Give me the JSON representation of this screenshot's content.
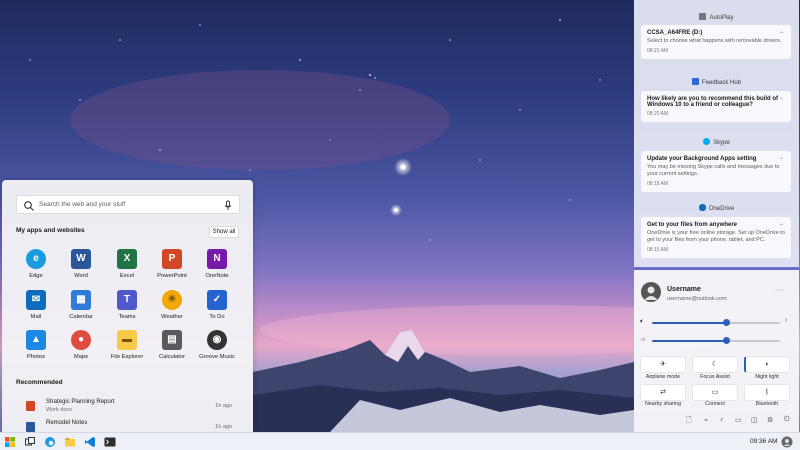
{
  "start_menu": {
    "search_placeholder": "Search the web and your stuff",
    "apps_header": "My apps and websites",
    "show_all": "Show all",
    "apps": [
      {
        "label": "Edge",
        "icon": "edge-icon",
        "color": "#1a9be0"
      },
      {
        "label": "Word",
        "icon": "word-icon",
        "color": "#2b579a"
      },
      {
        "label": "Excel",
        "icon": "excel-icon",
        "color": "#217346"
      },
      {
        "label": "PowerPoint",
        "icon": "powerpoint-icon",
        "color": "#d24726"
      },
      {
        "label": "OneNote",
        "icon": "onenote-icon",
        "color": "#7719aa"
      },
      {
        "label": "Mail",
        "icon": "mail-icon",
        "color": "#0f6cbd"
      },
      {
        "label": "Calendar",
        "icon": "calendar-icon",
        "color": "#2f7bd9"
      },
      {
        "label": "Teams",
        "icon": "teams-icon",
        "color": "#5059c9"
      },
      {
        "label": "Weather",
        "icon": "weather-icon",
        "color": "#f2a70b"
      },
      {
        "label": "To Do",
        "icon": "todo-icon",
        "color": "#2564cf"
      },
      {
        "label": "Photos",
        "icon": "photos-icon",
        "color": "#1e88e5"
      },
      {
        "label": "Maps",
        "icon": "maps-icon",
        "color": "#e04b3f"
      },
      {
        "label": "File Explorer",
        "icon": "file-explorer-icon",
        "color": "#f7c948"
      },
      {
        "label": "Calculator",
        "icon": "calculator-icon",
        "color": "#5a5a5a"
      },
      {
        "label": "Groove Music",
        "icon": "groove-music-icon",
        "color": "#333333"
      }
    ],
    "recommended_header": "Recommended",
    "recommended": [
      {
        "title": "Strategic Planning Report",
        "subtitle": "Work docs",
        "time": "1h ago",
        "color": "#d24726"
      },
      {
        "title": "Remodel Notes",
        "subtitle": "",
        "time": "1h ago",
        "color": "#2b579a"
      }
    ]
  },
  "notifications": [
    {
      "app": "AutoPlay",
      "color": "#555555",
      "title": "CCSA_A64FRE (D:)",
      "body": "Select to choose what happens with removable drivers.",
      "time": "08:21 AM"
    },
    {
      "app": "Feedback Hub",
      "color": "#2b6bd6",
      "title": "How likely are you to recommend this build of Windows 10 to a friend or colleague?",
      "body": "",
      "time": "08:20 AM"
    },
    {
      "app": "Skype",
      "color": "#00aff0",
      "title": "Update your Background Apps setting",
      "body": "You may be missing Skype calls and messages due to your current settings.",
      "time": "08:18 AM"
    },
    {
      "app": "OneDrive",
      "color": "#0f6cbd",
      "title": "Get to your files from anywhere",
      "body": "OneDrive is your free online storage. Set up OneDrive to get to your files from your phone, tablet, and PC.",
      "time": "08:15 AM"
    }
  ],
  "quick_settings": {
    "username": "Username",
    "email": "username@outlook.com",
    "more": "···",
    "volume_level": 0.58,
    "brightness_level": 0.58,
    "tiles": [
      {
        "label": "Airplane mode",
        "icon": "airplane-icon",
        "glyph": "✈",
        "on": false
      },
      {
        "label": "Focus Assist",
        "icon": "focus-assist-icon",
        "glyph": "☾",
        "on": false
      },
      {
        "label": "Night light",
        "icon": "night-light-icon",
        "glyph": "◐",
        "on": true
      },
      {
        "label": "Nearby sharing",
        "icon": "nearby-sharing-icon",
        "glyph": "⇄",
        "on": false
      },
      {
        "label": "Connect",
        "icon": "connect-icon",
        "glyph": "▭",
        "on": false
      },
      {
        "label": "Bluetooth",
        "icon": "bluetooth-icon",
        "glyph": "ᛒ",
        "on": false
      }
    ]
  },
  "taskbar": {
    "clock": "09:36 AM"
  },
  "colors": {
    "accent": "#2b5fb8",
    "windows_logo": [
      "#f25022",
      "#7fba00",
      "#00a4ef",
      "#ffb900"
    ]
  }
}
